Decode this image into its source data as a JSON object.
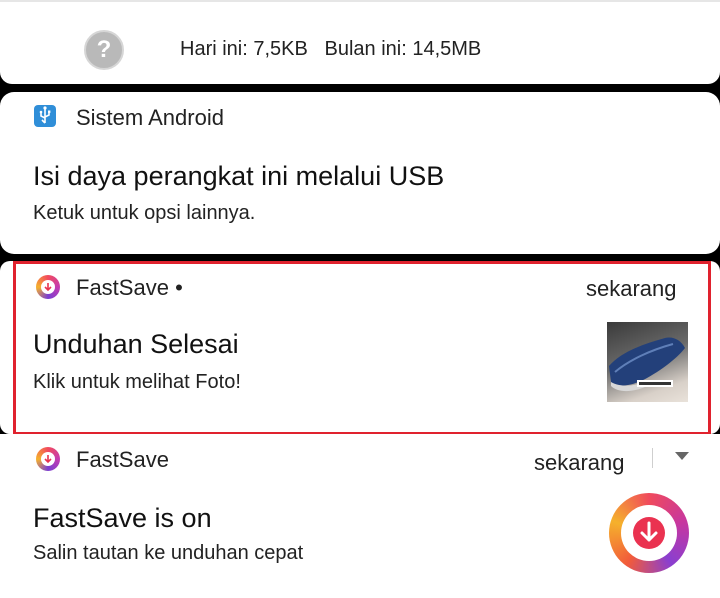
{
  "data_usage": {
    "today": "Hari ini: 7,5KB",
    "month": "Bulan ini: 14,5MB",
    "icon": "question-icon"
  },
  "android_notification": {
    "app_name": "Sistem Android",
    "title": "Isi daya perangkat ini melalui USB",
    "subtitle": "Ketuk untuk opsi lainnya.",
    "icon": "usb-icon"
  },
  "fastsave_download": {
    "app_name": "FastSave",
    "dot": "•",
    "time": "sekarang",
    "title": "Unduhan Selesai",
    "subtitle": "Klik untuk melihat Foto!",
    "thumbnail": "shoe-photo",
    "highlight_color": "#e0222e"
  },
  "fastsave_status": {
    "app_name": "FastSave",
    "time": "sekarang",
    "title": "FastSave is on",
    "subtitle": "Salin tautan ke unduhan cepat",
    "icon": "fastsave-download-icon"
  }
}
